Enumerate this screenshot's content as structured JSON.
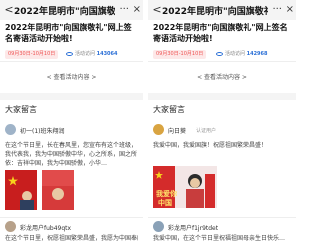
{
  "panels": [
    {
      "topbar": {
        "back": "<",
        "title": "2022年昆明市\"向国旗敬礼\"网...",
        "more": "···",
        "close": "×"
      },
      "event": {
        "title": "2022年昆明市\"向国旗敬礼\"网上签名寄语活动开始啦!",
        "dates": "09月30日-10月10日",
        "views_label": "活动访问",
        "views": "143064",
        "link": "< 查看活动内容 >"
      },
      "section_title": "大家留言",
      "comments": [
        {
          "name": "初一(1)班朱翔润",
          "text": "在这个节日里，长在春风里，您宣布有这个班级，我代表我，我为中国骄傲中华，心之所系，国之所依：吉祥中国，我为中国骄傲，小华…",
          "photo": "flag-photo"
        },
        {
          "name": "彩龙用户fub49qtx",
          "text": "在这个节日里，祝愿祖国繁荣昌盛，我愿为中国奉献，我爱您中国…"
        }
      ]
    },
    {
      "topbar": {
        "back": "<",
        "title": "2022年昆明市\"向国旗敬礼\"网...",
        "more": "···",
        "close": "×"
      },
      "event": {
        "title": "2022年昆明市\"向国旗敬礼\"网上签名寄语活动开始啦!",
        "dates": "09月30日-10月10日",
        "views_label": "活动访问",
        "views": "142968",
        "link": "< 查看活动内容 >"
      },
      "section_title": "大家留言",
      "comments": [
        {
          "name": "向日葵",
          "badge": "认证用户",
          "text": "我爱中国，我爱国旗！祝愿祖国繁荣昌盛！",
          "photo": "i-love-china-photo"
        },
        {
          "name": "彩龙用户f1jr9tdet",
          "text": "我爱中国，在这个节日里祝福祖国母亲生日快乐…"
        }
      ]
    }
  ]
}
